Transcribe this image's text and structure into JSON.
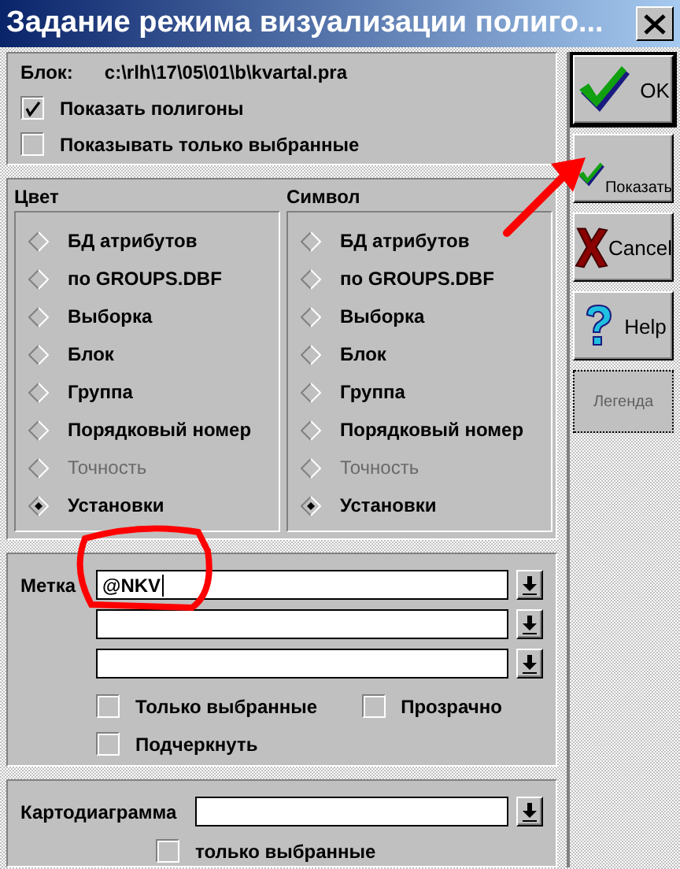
{
  "window": {
    "title": "Задание режима визуализации полиго..."
  },
  "block": {
    "label": "Блок:",
    "path": "c:\\rlh\\17\\05\\01\\b\\kvartal.pra"
  },
  "options": [
    {
      "label": "Показать полигоны",
      "checked": true
    },
    {
      "label": "Показывать только выбранные",
      "checked": false
    }
  ],
  "groups": [
    {
      "title": "Цвет",
      "items": [
        {
          "label": "БД атрибутов",
          "selected": false,
          "disabled": false
        },
        {
          "label": "по GROUPS.DBF",
          "selected": false,
          "disabled": false
        },
        {
          "label": "Выборка",
          "selected": false,
          "disabled": false
        },
        {
          "label": "Блок",
          "selected": false,
          "disabled": false
        },
        {
          "label": "Группа",
          "selected": false,
          "disabled": false
        },
        {
          "label": "Порядковый номер",
          "selected": false,
          "disabled": false
        },
        {
          "label": "Точность",
          "selected": false,
          "disabled": true
        },
        {
          "label": "Установки",
          "selected": true,
          "disabled": false
        }
      ]
    },
    {
      "title": "Символ",
      "items": [
        {
          "label": "БД атрибутов",
          "selected": false,
          "disabled": false
        },
        {
          "label": "по GROUPS.DBF",
          "selected": false,
          "disabled": false
        },
        {
          "label": "Выборка",
          "selected": false,
          "disabled": false
        },
        {
          "label": "Блок",
          "selected": false,
          "disabled": false
        },
        {
          "label": "Группа",
          "selected": false,
          "disabled": false
        },
        {
          "label": "Порядковый номер",
          "selected": false,
          "disabled": false
        },
        {
          "label": "Точность",
          "selected": false,
          "disabled": true
        },
        {
          "label": "Установки",
          "selected": true,
          "disabled": false
        }
      ]
    }
  ],
  "label_section": {
    "label": "Метка",
    "fields": [
      {
        "value": "@NKV",
        "focused": true
      },
      {
        "focused": false
      },
      {
        "focused": false
      }
    ],
    "checkboxes": [
      {
        "label": "Только выбранные",
        "checked": false
      },
      {
        "label": "Прозрачно",
        "checked": false
      },
      {
        "label": "Подчеркнуть",
        "checked": false
      }
    ]
  },
  "chart_section": {
    "label": "Картодиаграмма",
    "field": {
      "focused": false
    },
    "only_selected": {
      "label": "только выбранные",
      "checked": false
    }
  },
  "buttons": [
    {
      "label": "OK",
      "kind": "ok",
      "default": true,
      "disabled": false
    },
    {
      "label": "Показать",
      "kind": "show",
      "default": false,
      "disabled": false
    },
    {
      "label": "Cancel",
      "kind": "cancel",
      "default": false,
      "disabled": false
    },
    {
      "label": "Help",
      "kind": "help",
      "default": false,
      "disabled": false
    },
    {
      "label": "Легенда",
      "kind": "none",
      "default": false,
      "disabled": true
    }
  ]
}
